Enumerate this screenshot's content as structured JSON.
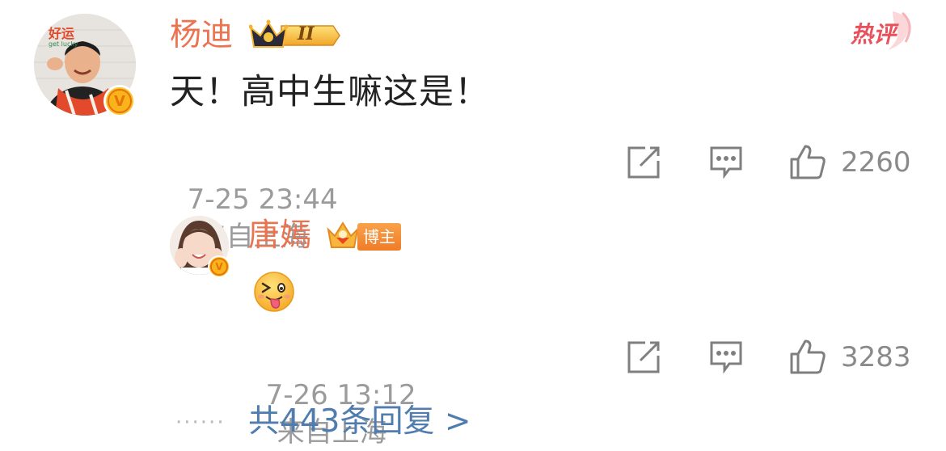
{
  "comment": {
    "username": "杨迪",
    "vip_level": "II",
    "hot_tag": "热评",
    "text": "天！高中生嘛这是！",
    "time": "7-25 23:44",
    "location": "来自上海",
    "like_count": "2260"
  },
  "reply": {
    "username": "唐嫣",
    "role_badge": "博主",
    "emoji": "tongue-wink-emoji",
    "time": "7-26 13:12",
    "location": "来自上海",
    "like_count": "3283"
  },
  "footer": {
    "dots": "······",
    "more_replies": "共443条回复 >"
  },
  "colors": {
    "username": "#eb7350",
    "meta": "#9b9b9b",
    "link": "#507daf",
    "hot": "#e8505b",
    "verified": "#f7c22b"
  }
}
